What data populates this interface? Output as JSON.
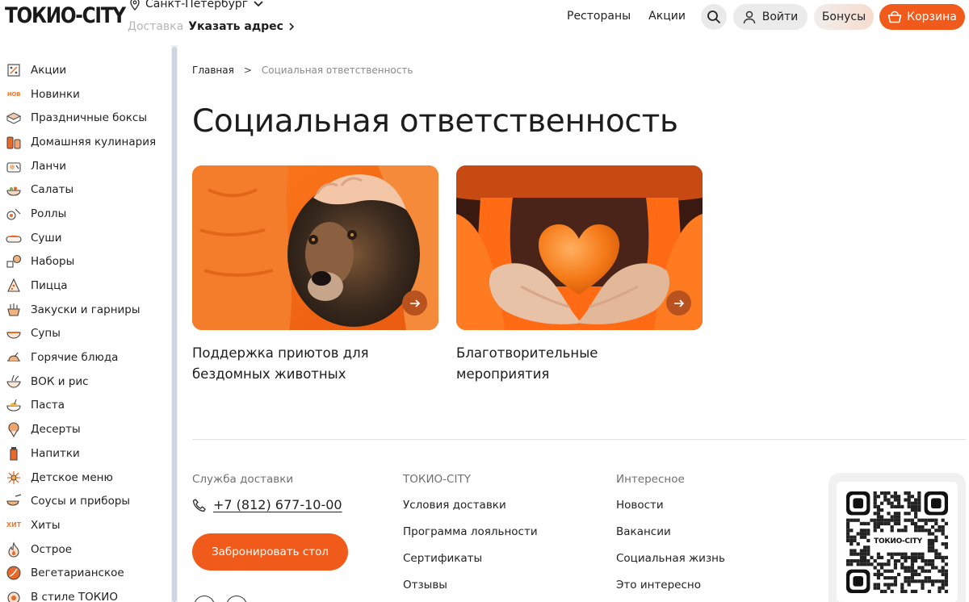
{
  "header": {
    "logo": "ТОКИО-CITY",
    "city": "Санкт-Петербург",
    "delivery_label": "Доставка",
    "address_label": "Указать адрес",
    "nav": [
      "Рестораны",
      "Акции"
    ],
    "login_label": "Войти",
    "bonus_label": "Бонусы",
    "cart_label": "Корзина"
  },
  "sidebar": {
    "items": [
      {
        "label": "Акции",
        "icon": "discount-tag-icon"
      },
      {
        "label": "Новинки",
        "icon": "new-badge-icon"
      },
      {
        "label": "Праздничные боксы",
        "icon": "gift-box-icon"
      },
      {
        "label": "Домашняя кулинария",
        "icon": "home-cooking-icon"
      },
      {
        "label": "Ланчи",
        "icon": "lunch-icon"
      },
      {
        "label": "Салаты",
        "icon": "salad-icon"
      },
      {
        "label": "Роллы",
        "icon": "rolls-icon"
      },
      {
        "label": "Суши",
        "icon": "sushi-icon"
      },
      {
        "label": "Наборы",
        "icon": "sets-icon"
      },
      {
        "label": "Пицца",
        "icon": "pizza-icon"
      },
      {
        "label": "Закуски и гарниры",
        "icon": "snacks-icon"
      },
      {
        "label": "Супы",
        "icon": "soup-icon"
      },
      {
        "label": "Горячие блюда",
        "icon": "hot-dish-icon"
      },
      {
        "label": "ВОК и рис",
        "icon": "wok-icon"
      },
      {
        "label": "Паста",
        "icon": "pasta-icon"
      },
      {
        "label": "Десерты",
        "icon": "dessert-icon"
      },
      {
        "label": "Напитки",
        "icon": "drink-icon"
      },
      {
        "label": "Детское меню",
        "icon": "kids-menu-icon"
      },
      {
        "label": "Соусы и приборы",
        "icon": "sauce-icon"
      },
      {
        "label": "Хиты",
        "icon": "hit-badge-icon"
      },
      {
        "label": "Острое",
        "icon": "spicy-icon"
      },
      {
        "label": "Вегетарианское",
        "icon": "vegetarian-icon"
      },
      {
        "label": "В стиле ТОКИО",
        "icon": "tokio-style-icon"
      }
    ],
    "new_badge_text": "НОВ",
    "hit_badge_text": "ХИТ"
  },
  "main": {
    "breadcrumb": {
      "home": "Главная",
      "separator": ">",
      "current": "Социальная ответственность"
    },
    "title": "Социальная ответственность",
    "cards": [
      {
        "title": "Поддержка приютов для бездомных животных"
      },
      {
        "title": "Благотворительные мероприятия"
      }
    ]
  },
  "footer": {
    "col1": {
      "heading": "Служба доставки",
      "phone": "+7 (812) 677-10-00",
      "reserve_label": "Забронировать стол"
    },
    "col2": {
      "heading": "ТОКИО-CITY",
      "links": [
        "Условия доставки",
        "Программа лояльности",
        "Сертификаты",
        "Отзывы"
      ]
    },
    "col3": {
      "heading": "Интересное",
      "links": [
        "Новости",
        "Вакансии",
        "Социальная жизнь",
        "Это интересно"
      ]
    },
    "qr_label": "ТОКИО-CITY"
  },
  "colors": {
    "accent": "#f05a1a",
    "card_arrow": "#b8531f",
    "muted_text": "#8a8a8a"
  }
}
